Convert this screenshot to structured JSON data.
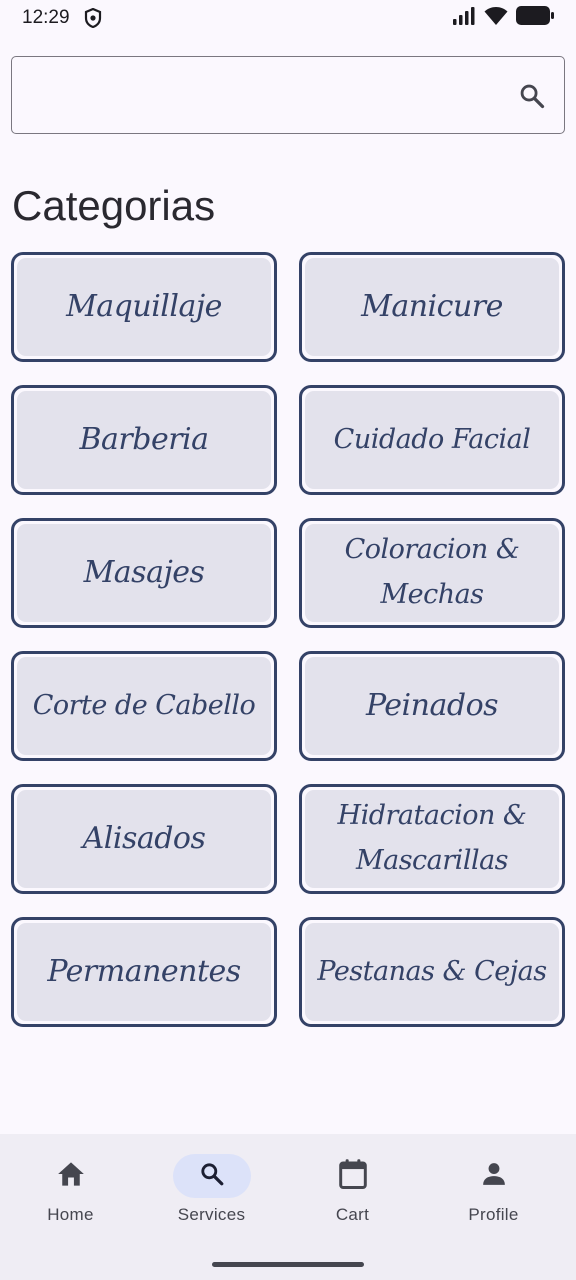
{
  "status": {
    "time": "12:29"
  },
  "search": {
    "value": "",
    "placeholder": ""
  },
  "section_title": "Categorias",
  "categories": [
    {
      "label": "Maquillaje"
    },
    {
      "label": "Manicure"
    },
    {
      "label": "Barberia"
    },
    {
      "label": "Cuidado Facial"
    },
    {
      "label": "Masajes"
    },
    {
      "label": "Coloracion & Mechas"
    },
    {
      "label": "Corte de Cabello"
    },
    {
      "label": "Peinados"
    },
    {
      "label": "Alisados"
    },
    {
      "label": "Hidratacion & Mascarillas"
    },
    {
      "label": "Permanentes"
    },
    {
      "label": "Pestanas & Cejas"
    }
  ],
  "nav": {
    "items": [
      {
        "label": "Home",
        "icon": "home-icon"
      },
      {
        "label": "Services",
        "icon": "search-icon",
        "active": true
      },
      {
        "label": "Cart",
        "icon": "calendar-icon"
      },
      {
        "label": "Profile",
        "icon": "person-icon"
      }
    ]
  },
  "colors": {
    "background": "#fbf8fe",
    "card_border": "#344267",
    "card_fill": "#e3e2ec",
    "nav_background": "#efedf4",
    "nav_active_pill": "#dce2f9"
  }
}
